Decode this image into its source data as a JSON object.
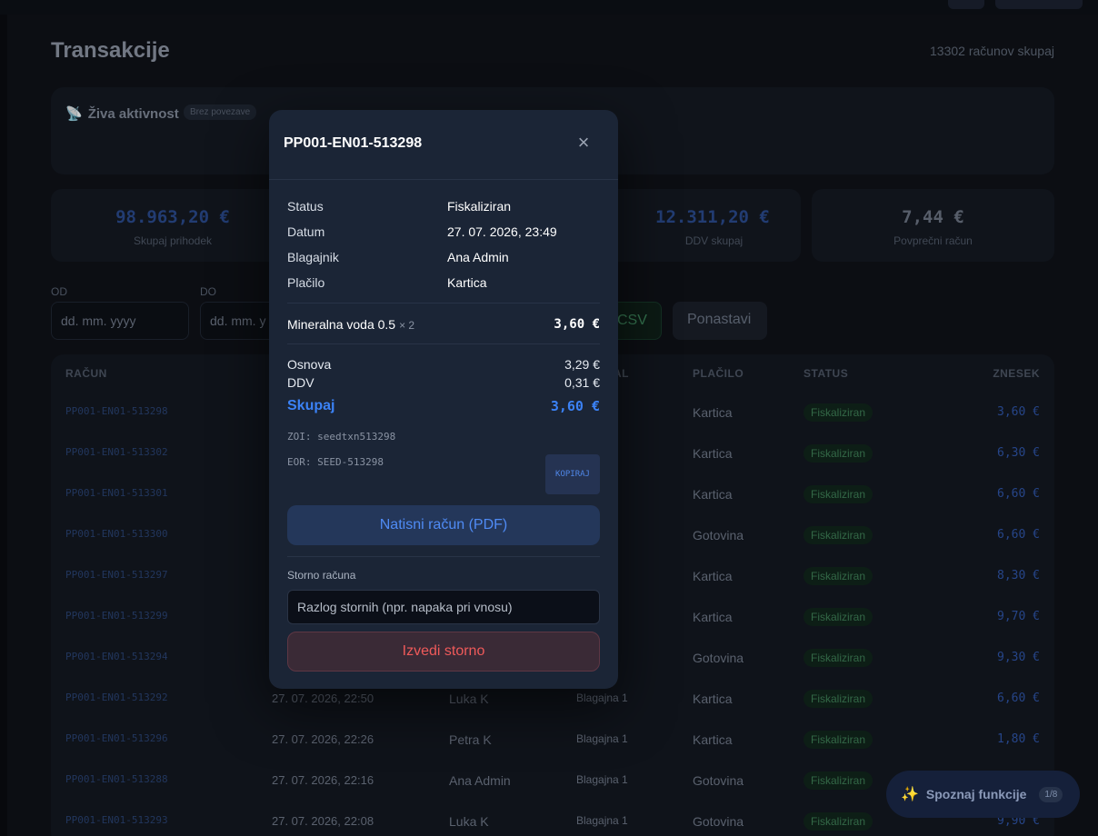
{
  "page": {
    "title": "Transakcije",
    "count_text": "13302 računov skupaj"
  },
  "live": {
    "title": "Živa aktivnost",
    "badge": "Brez povezave"
  },
  "stats": [
    {
      "value": "98.963,20 €",
      "label": "Skupaj prihodek"
    },
    {
      "value": "12.311,20 €",
      "label": "DDV skupaj"
    },
    {
      "value": "7,44 €",
      "label": "Povprečni račun"
    }
  ],
  "filters": {
    "from_label": "OD",
    "to_label": "DO",
    "from_placeholder": "dd. mm. yyyy",
    "to_placeholder": "dd. mm. y",
    "csv_label": "CSV",
    "reset_label": "Ponastavi"
  },
  "table": {
    "headers": {
      "racun": "RAČUN",
      "al": "AL",
      "placilo": "PLAČILO",
      "status": "STATUS",
      "znesek": "ZNESEK"
    },
    "rows": [
      {
        "id": "PP001-EN01-513298",
        "date": "",
        "cashier": "",
        "register": "a 1",
        "payment": "Kartica",
        "status": "Fiskaliziran",
        "amount": "3,60 €"
      },
      {
        "id": "PP001-EN01-513302",
        "date": "",
        "cashier": "",
        "register": "a 1",
        "payment": "Kartica",
        "status": "Fiskaliziran",
        "amount": "6,30 €"
      },
      {
        "id": "PP001-EN01-513301",
        "date": "",
        "cashier": "",
        "register": "a 1",
        "payment": "Kartica",
        "status": "Fiskaliziran",
        "amount": "6,60 €"
      },
      {
        "id": "PP001-EN01-513300",
        "date": "",
        "cashier": "",
        "register": "a 1",
        "payment": "Gotovina",
        "status": "Fiskaliziran",
        "amount": "6,60 €"
      },
      {
        "id": "PP001-EN01-513297",
        "date": "",
        "cashier": "",
        "register": "a 1",
        "payment": "Kartica",
        "status": "Fiskaliziran",
        "amount": "8,30 €"
      },
      {
        "id": "PP001-EN01-513299",
        "date": "",
        "cashier": "",
        "register": "a 1",
        "payment": "Kartica",
        "status": "Fiskaliziran",
        "amount": "9,70 €"
      },
      {
        "id": "PP001-EN01-513294",
        "date": "",
        "cashier": "",
        "register": "a 1",
        "payment": "Gotovina",
        "status": "Fiskaliziran",
        "amount": "9,30 €"
      },
      {
        "id": "PP001-EN01-513292",
        "date": "27. 07. 2026, 22:50",
        "cashier": "Luka K",
        "register": "Blagajna 1",
        "payment": "Kartica",
        "status": "Fiskaliziran",
        "amount": "6,60 €"
      },
      {
        "id": "PP001-EN01-513296",
        "date": "27. 07. 2026, 22:26",
        "cashier": "Petra K",
        "register": "Blagajna 1",
        "payment": "Kartica",
        "status": "Fiskaliziran",
        "amount": "1,80 €"
      },
      {
        "id": "PP001-EN01-513288",
        "date": "27. 07. 2026, 22:16",
        "cashier": "Ana Admin",
        "register": "Blagajna 1",
        "payment": "Gotovina",
        "status": "Fiskaliziran",
        "amount": ""
      },
      {
        "id": "PP001-EN01-513293",
        "date": "27. 07. 2026, 22:08",
        "cashier": "Luka K",
        "register": "Blagajna 1",
        "payment": "Gotovina",
        "status": "Fiskaliziran",
        "amount": "9,90 €"
      }
    ]
  },
  "modal": {
    "title": "PP001-EN01-513298",
    "fields": [
      {
        "key": "Status",
        "value": "Fiskaliziran"
      },
      {
        "key": "Datum",
        "value": "27. 07. 2026, 23:49"
      },
      {
        "key": "Blagajnik",
        "value": "Ana Admin"
      },
      {
        "key": "Plačilo",
        "value": "Kartica"
      }
    ],
    "item": {
      "name": "Mineralna voda 0.5",
      "qty": "× 2",
      "price": "3,60 €"
    },
    "osnova_label": "Osnova",
    "osnova_value": "3,29 €",
    "ddv_label": "DDV",
    "ddv_value": "0,31 €",
    "total_label": "Skupaj",
    "total_value": "3,60 €",
    "zoi": "ZOI: seedtxn513298",
    "eor": "EOR: SEED-513298",
    "copy_label": "KOPIRAJ",
    "print_label": "Natisni račun (PDF)",
    "storno_label": "Storno računa",
    "reason_placeholder": "Razlog stornih (npr. napaka pri vnosu)",
    "storno_button": "Izvedi storno"
  },
  "tour": {
    "label": "Spoznaj funkcije",
    "badge": "1/8"
  },
  "colors": {
    "accent": "#3b82f6",
    "danger": "#ef5a5a",
    "success": "#3f7f57"
  }
}
